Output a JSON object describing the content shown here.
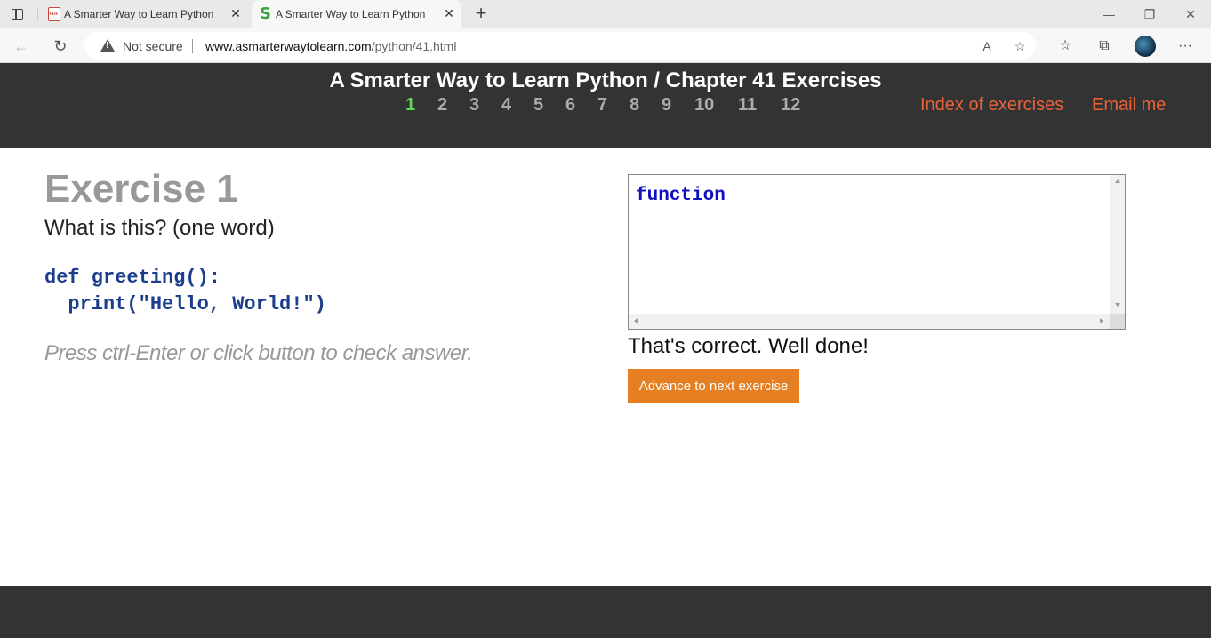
{
  "browser": {
    "tabs": [
      {
        "title": "A Smarter Way to Learn Python -",
        "icon": "pdf-icon",
        "close": "✕"
      },
      {
        "title": "A Smarter Way to Learn Python -",
        "icon": "s-icon",
        "icon_text": "S",
        "close": "✕"
      }
    ],
    "new_tab": "+",
    "window_controls": {
      "minimize": "—",
      "restore": "❐",
      "close": "✕"
    },
    "nav": {
      "back": "←",
      "refresh": "↻"
    },
    "security_label": "Not secure",
    "url_host": "www.asmarterwaytolearn.com",
    "url_path": "/python/41.html",
    "toolbar_icons": {
      "read_aloud": "A",
      "add_favorite": "☆",
      "favorites": "☆",
      "collections": "⧉",
      "more": "···"
    }
  },
  "header": {
    "title": "A Smarter Way to Learn Python / Chapter 41 Exercises",
    "exercise_numbers": [
      "1",
      "2",
      "3",
      "4",
      "5",
      "6",
      "7",
      "8",
      "9",
      "10",
      "11",
      "12"
    ],
    "active_exercise": "1",
    "active_color": "#5cd65c",
    "index_link": "Index of exercises",
    "email_link": "Email me",
    "link_color": "#e8623a"
  },
  "exercise": {
    "title": "Exercise 1",
    "question": "What is this? (one word)",
    "code_line1": "def greeting():",
    "code_line2": "  print(\"Hello, World!\")",
    "hint": "Press ctrl-Enter or click button to check answer."
  },
  "answer": {
    "value": "function",
    "feedback": "That's correct. Well done!",
    "next_button": "Advance to next exercise",
    "button_color": "#e67e22"
  }
}
